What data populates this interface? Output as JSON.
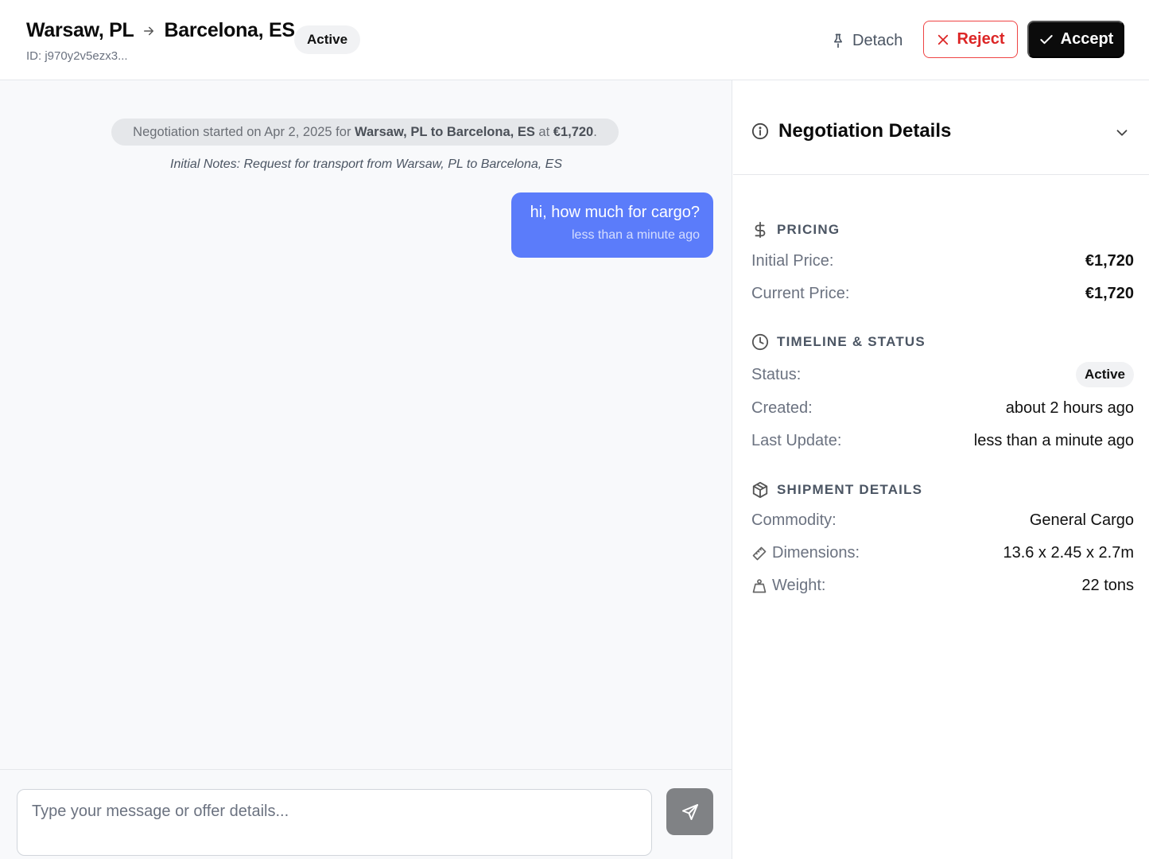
{
  "header": {
    "origin": "Warsaw, PL",
    "destination": "Barcelona, ES",
    "status": "Active",
    "id_label": "ID: j970y2v5ezx3...",
    "detach_label": "Detach",
    "reject_label": "Reject",
    "accept_label": "Accept"
  },
  "chat": {
    "system_message": {
      "prefix": "Negotiation started on Apr 2, 2025 for ",
      "route": "Warsaw, PL to Barcelona, ES",
      "middle": " at ",
      "price": "€1,720",
      "suffix": "."
    },
    "initial_notes": "Initial Notes: Request for transport from Warsaw, PL to Barcelona, ES",
    "messages": [
      {
        "text": "hi, how much for cargo?",
        "time": "less than a minute ago"
      }
    ]
  },
  "composer": {
    "placeholder": "Type your message or offer details..."
  },
  "details": {
    "title": "Negotiation Details",
    "pricing": {
      "heading": "PRICING",
      "initial_label": "Initial Price:",
      "initial_value": "€1,720",
      "current_label": "Current Price:",
      "current_value": "€1,720"
    },
    "timeline": {
      "heading": "TIMELINE & STATUS",
      "status_label": "Status:",
      "status_value": "Active",
      "created_label": "Created:",
      "created_value": "about 2 hours ago",
      "updated_label": "Last Update:",
      "updated_value": "less than a minute ago"
    },
    "shipment": {
      "heading": "SHIPMENT DETAILS",
      "commodity_label": "Commodity:",
      "commodity_value": "General Cargo",
      "dimensions_label": "Dimensions:",
      "dimensions_value": "13.6 x 2.45 x 2.7m",
      "weight_label": "Weight:",
      "weight_value": "22 tons"
    }
  }
}
